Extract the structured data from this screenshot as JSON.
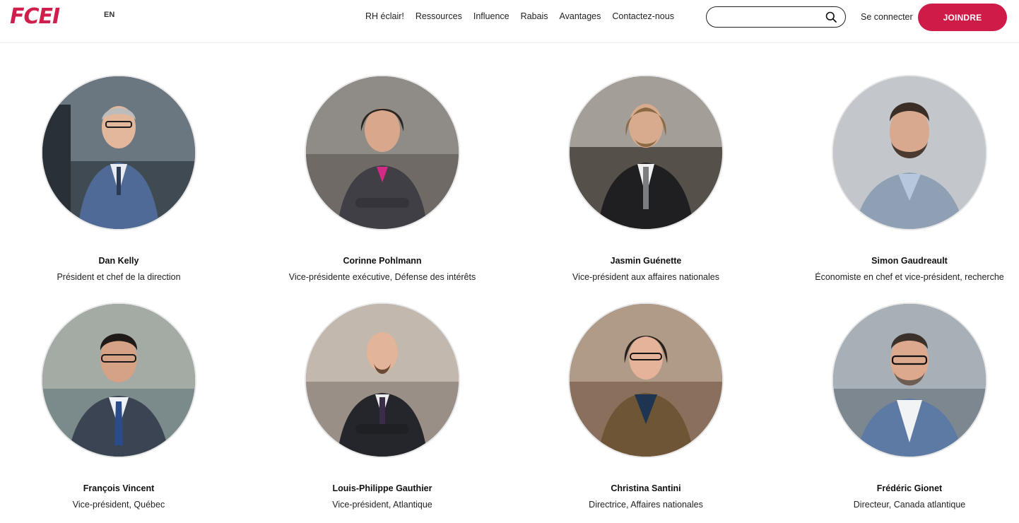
{
  "header": {
    "logo": "FCEI",
    "lang": "EN",
    "nav": [
      "RH éclair!",
      "Ressources",
      "Influence",
      "Rabais",
      "Avantages",
      "Contactez-nous"
    ],
    "search_value": "",
    "login": "Se connecter",
    "join": "JOINDRE",
    "brand_color": "#cf1b47"
  },
  "team": [
    {
      "name": "Dan Kelly",
      "title": "Président et chef de la direction"
    },
    {
      "name": "Corinne Pohlmann",
      "title": "Vice-présidente exécutive, Défense des intérêts"
    },
    {
      "name": "Jasmin Guénette",
      "title": "Vice-président aux affaires nationales"
    },
    {
      "name": "Simon Gaudreault",
      "title": "Économiste en chef et vice-président, recherche"
    },
    {
      "name": "François Vincent",
      "title": "Vice-président, Québec"
    },
    {
      "name": "Louis-Philippe Gauthier",
      "title": "Vice-président, Atlantique"
    },
    {
      "name": "Christina Santini",
      "title": "Directrice, Affaires nationales"
    },
    {
      "name": "Frédéric Gionet",
      "title": "Directeur, Canada atlantique"
    }
  ]
}
